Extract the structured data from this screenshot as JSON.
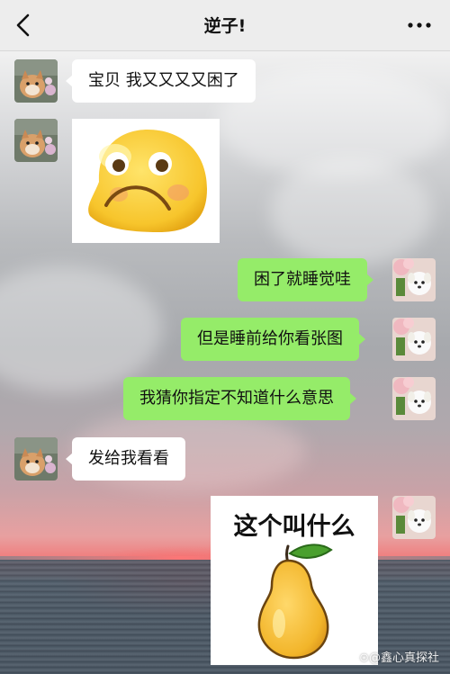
{
  "header": {
    "title": "逆子!",
    "back_icon": "chevron-left-icon",
    "more_icon": "more-dots-icon"
  },
  "colors": {
    "topbar": "#ededed",
    "incoming_bubble": "#ffffff",
    "outgoing_bubble": "#95ec69"
  },
  "messages": [
    {
      "side": "left",
      "type": "text",
      "text": "宝贝  我又又又又困了"
    },
    {
      "side": "left",
      "type": "sticker",
      "sticker": "sad-face-emoji"
    },
    {
      "side": "right",
      "type": "text",
      "text": "困了就睡觉哇"
    },
    {
      "side": "right",
      "type": "text",
      "text": "但是睡前给你看张图"
    },
    {
      "side": "right",
      "type": "text",
      "text": "我猜你指定不知道什么意思"
    },
    {
      "side": "left",
      "type": "text",
      "text": "发给我看看"
    },
    {
      "side": "right",
      "type": "sticker",
      "sticker": "pear-picture",
      "caption": "这个叫什么"
    }
  ],
  "watermark": "⊙@鑫心真探社"
}
